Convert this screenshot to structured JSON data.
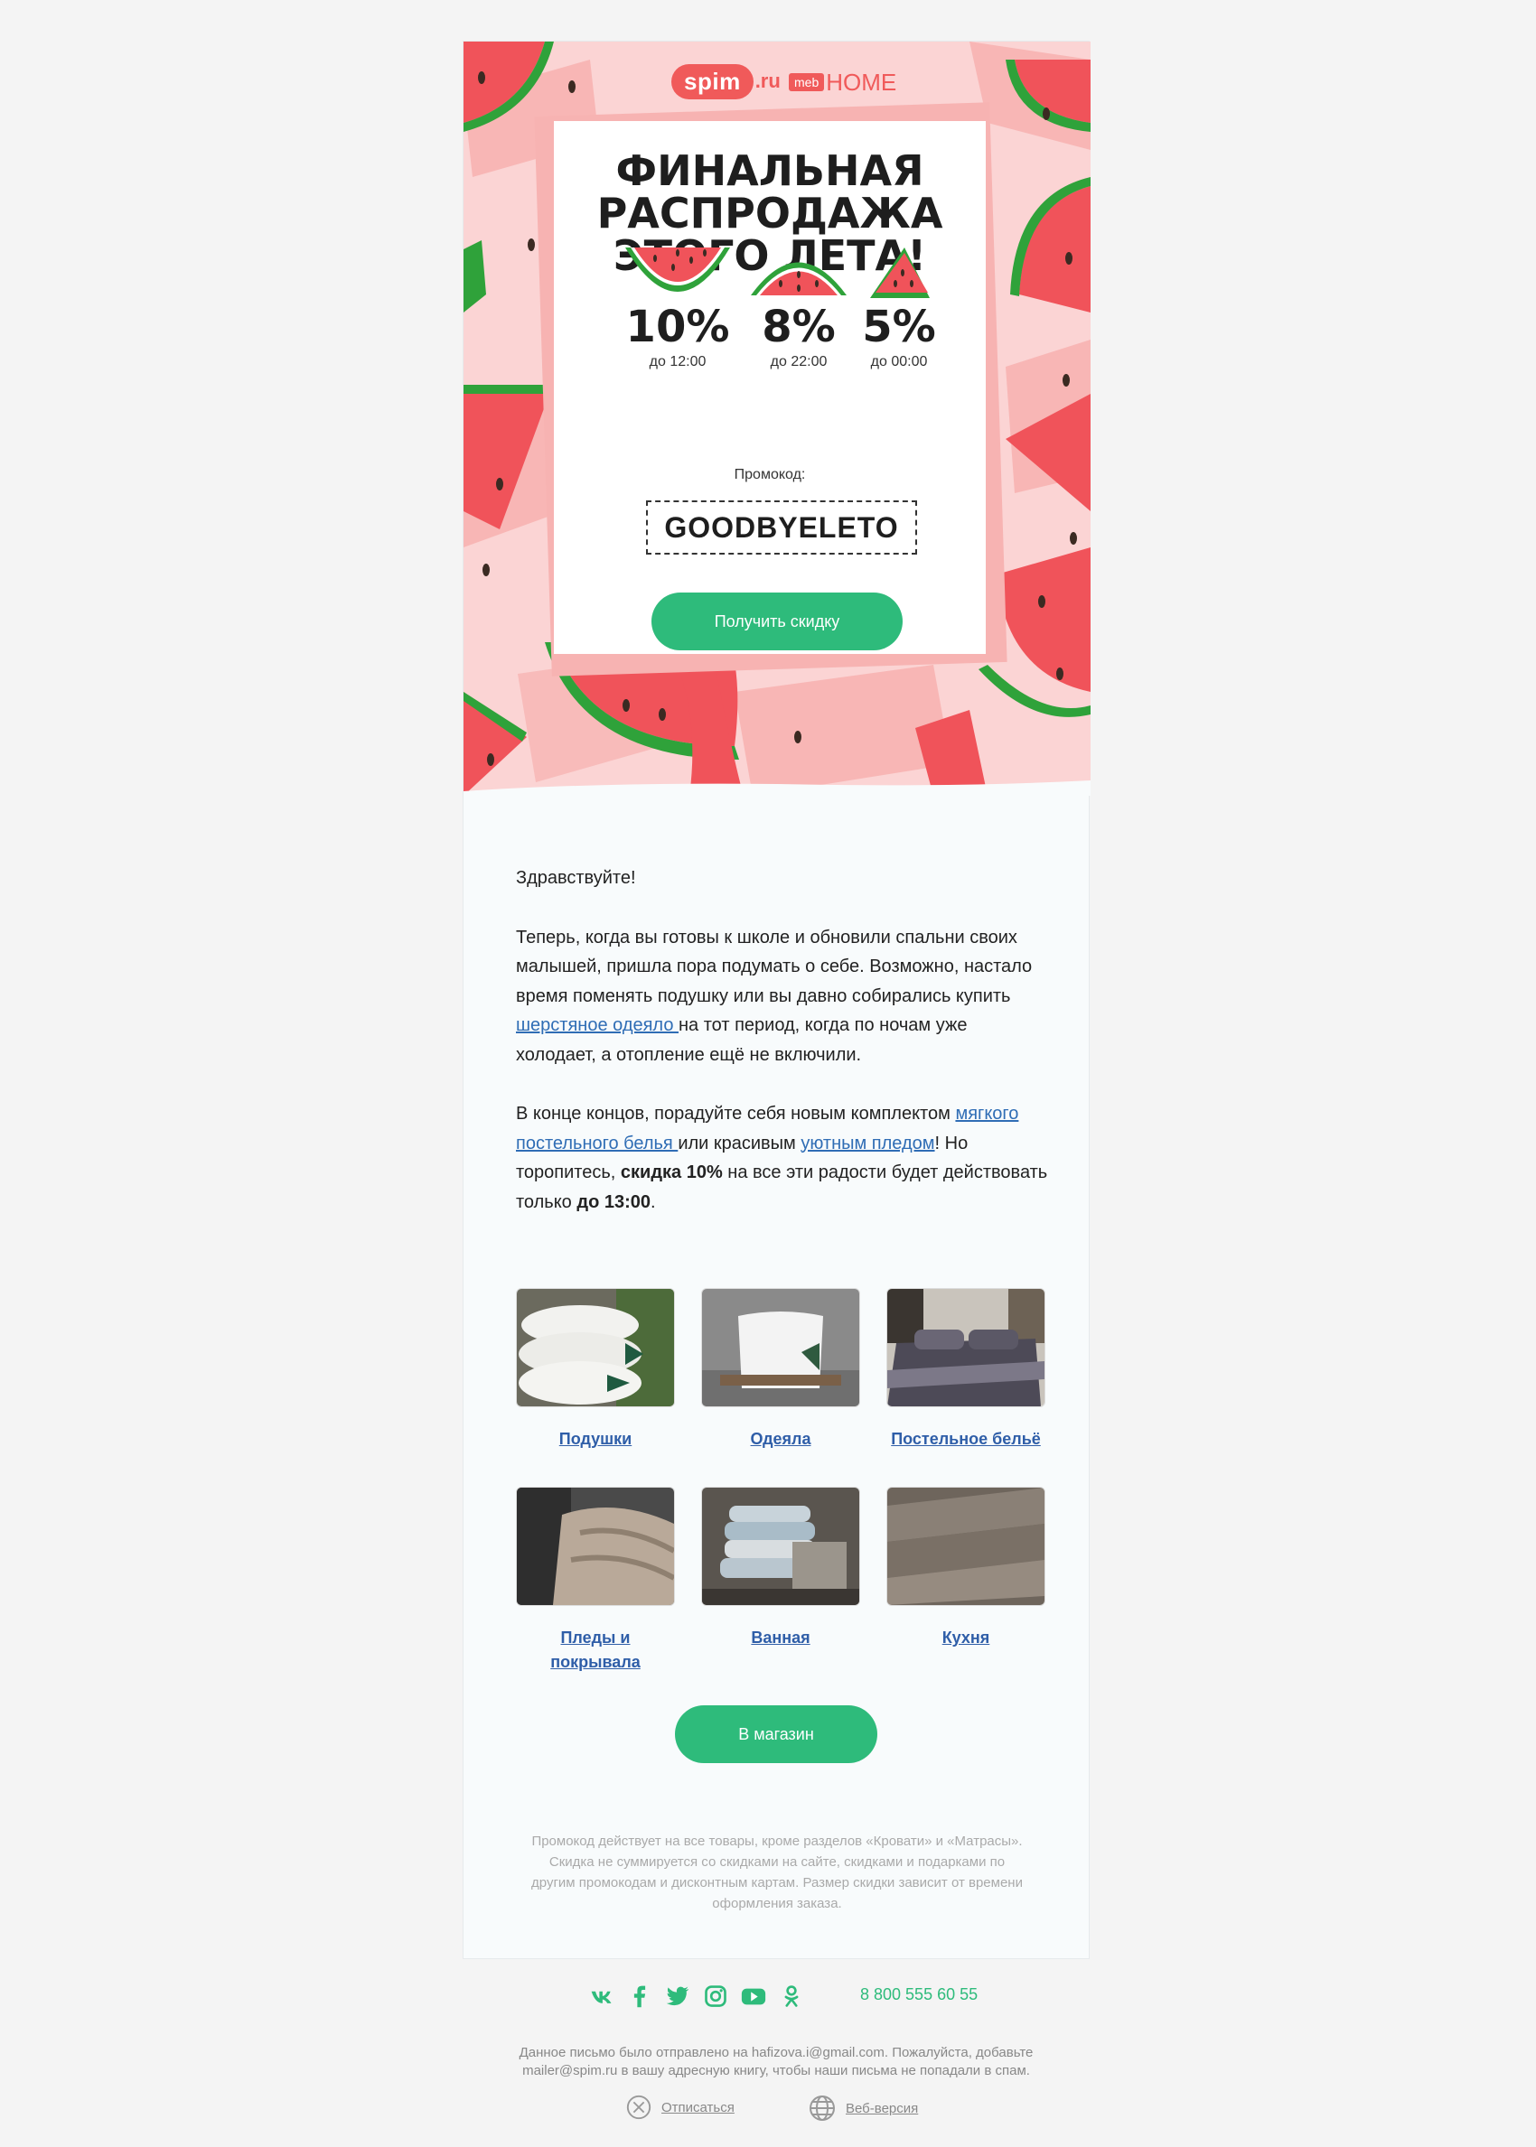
{
  "header": {
    "spim_logo_main": "spim",
    "spim_logo_suffix": ".ru",
    "meb_logo_tag": "meb",
    "meb_logo_text": "HOME"
  },
  "hero": {
    "title_line1": "ФИНАЛЬНАЯ",
    "title_line2": "РАСПРОДАЖА",
    "title_line3": "ЭТОГО ЛЕТА!",
    "discounts": [
      {
        "percent": "10%",
        "until": "до 12:00"
      },
      {
        "percent": "8%",
        "until": "до 22:00"
      },
      {
        "percent": "5%",
        "until": "до 00:00"
      }
    ],
    "promo_label": "Промокод:",
    "promo_code": "GOODBYELETO",
    "cta_label": "Получить скидку"
  },
  "body": {
    "greeting": "Здравствуйте!",
    "p1_before": "Теперь, когда вы готовы к школе и обновили спальни своих малышей, пришла пора подумать о себе. Возможно, настало время поменять подушку или вы давно собирались купить ",
    "p1_link": "шерстяное одеяло ",
    "p1_after": "на тот период, когда по ночам уже холодает, а отопление ещё не включили.",
    "p2_before": "В конце концов, порадуйте себя новым комплектом ",
    "p2_link1": "мягкого постельного белья ",
    "p2_mid": "или красивым ",
    "p2_link2": "уютным пледом",
    "p2_mid2": "! Но торопитесь, ",
    "p2_bold1": "скидка 10%",
    "p2_mid3": " на все эти радости будет действовать только ",
    "p2_bold2": "до 13:00",
    "p2_end": "."
  },
  "products": [
    {
      "label": "Подушки",
      "icon": "pillows-photo"
    },
    {
      "label": "Одеяла",
      "icon": "blanket-photo"
    },
    {
      "label": "Постельное бельё",
      "icon": "bedding-photo"
    },
    {
      "label": "Пледы и покрывала",
      "icon": "throw-photo"
    },
    {
      "label": "Ванная",
      "icon": "towels-photo"
    },
    {
      "label": "Кухня",
      "icon": "kitchen-textile-photo"
    }
  ],
  "shop_button": "В магазин",
  "disclaimer": "Промокод действует на все товары, кроме разделов «Кровати» и «Матрасы». Скидка не суммируется со скидками на сайте, скидками и подарками по другим промокодам и дисконтным картам. Размер скидки зависит от времени оформления заказа.",
  "footer": {
    "socials": [
      "vk-icon",
      "facebook-icon",
      "twitter-icon",
      "instagram-icon",
      "youtube-icon",
      "odnoklassniki-icon"
    ],
    "phone": "8 800 555 60 55",
    "notice_line1": "Данное письмо было отправлено на hafizova.i@gmail.com. Пожалуйста, добавьте",
    "notice_line2": "mailer@spim.ru в вашу адресную книгу, чтобы наши письма не попадали в спам.",
    "unsubscribe": "Отписаться",
    "web_version": "Веб-версия"
  },
  "colors": {
    "accent_green": "#2ebb7b",
    "brand_red": "#f05a5a",
    "link_blue": "#2f6db5",
    "hero_pink": "#fbd4d4"
  }
}
